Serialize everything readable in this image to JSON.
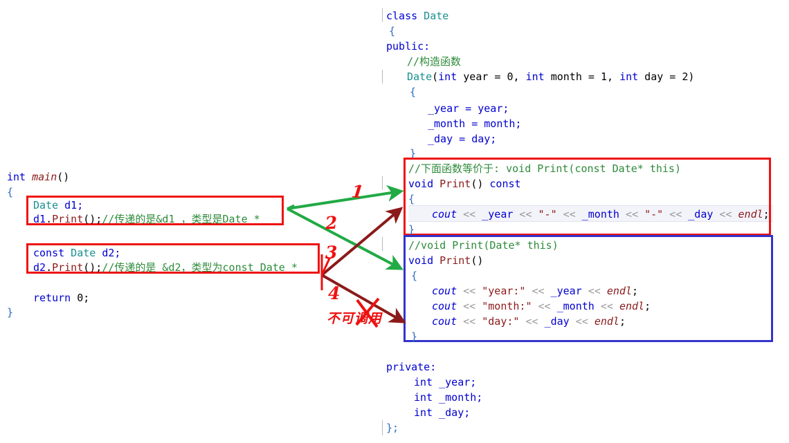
{
  "colors": {
    "keyword": "#0000d0",
    "user_type": "#1a8f8f",
    "function": "#8b1a1a",
    "comment": "#2e8b3a",
    "string": "#8b1a1a",
    "operator": "#9a9a9a",
    "box_red": "#ee1111",
    "box_blue": "#3333cc",
    "arrow_green": "#22aa44",
    "arrow_darkred": "#8b1a1a",
    "annotation_red": "#ee1111",
    "background": "#ffffff"
  },
  "left_code": {
    "line1_kw": "int",
    "line1_fn": "main",
    "line1_paren": "()",
    "line2": "{",
    "box1": {
      "l1_type": "Date",
      "l1_var": " d1;",
      "l2_var": "d1",
      "l2_dot": ".",
      "l2_fn": "Print",
      "l2_tail": "();",
      "l2_comment": "//传递的是&d1 ，类型是Date *"
    },
    "box2": {
      "l1_kw": "const",
      "l1_type": " Date",
      "l1_var": " d2;",
      "l2_var": "d2",
      "l2_dot": ".",
      "l2_fn": "Print",
      "l2_tail": "();",
      "l2_comment": "//传递的是 &d2，类型为const Date *"
    },
    "ret_kw": "return",
    "ret_val": " 0;",
    "close": "}"
  },
  "right_code": {
    "class_kw": "class",
    "class_name": " Date",
    "open_brace": "{",
    "public_kw": "public:",
    "ctor_comment": "//构造函数",
    "ctor_name": "Date",
    "ctor_sig": "(",
    "ctor_p1_kw": "int",
    "ctor_p1": " year = 0, ",
    "ctor_p2_kw": "int",
    "ctor_p2": " month = 1, ",
    "ctor_p3_kw": "int",
    "ctor_p3": " day = 2)",
    "ctor_open": "{",
    "assign1": "_year = year;",
    "assign2": "_month = month;",
    "assign3": "_day = day;",
    "ctor_close": "}",
    "private_kw": "private:",
    "member1_kw": "int",
    "member1": " _year;",
    "member2_kw": "int",
    "member2": " _month;",
    "member3_kw": "int",
    "member3": " _day;",
    "class_close": "};"
  },
  "red_box_code": {
    "comment": "//下面函数等价于: void Print(const Date* this)",
    "sig_kw": "void",
    "sig_fn": " Print",
    "sig_paren": "() ",
    "sig_const": "const",
    "open": "{",
    "body_cout": "cout",
    "body_op1": " << ",
    "body_year": "_year",
    "body_op2": " << ",
    "body_dash1": "\"-\"",
    "body_op3": " << ",
    "body_month": "_month",
    "body_op4": " << ",
    "body_dash2": "\"-\"",
    "body_op5": " << ",
    "body_day": "_day",
    "body_op6": " << ",
    "body_endl": "endl",
    "body_semi": ";",
    "close": "}"
  },
  "blue_box_code": {
    "comment": "//void Print(Date* this)",
    "sig_kw": "void",
    "sig_fn": " Print",
    "sig_paren": "()",
    "open": "{",
    "l1_cout": "cout",
    "l1_op1": " << ",
    "l1_str": "\"year:\"",
    "l1_op2": " << ",
    "l1_var": "_year",
    "l1_op3": " << ",
    "l1_endl": "endl",
    "l1_semi": ";",
    "l2_cout": "cout",
    "l2_op1": " << ",
    "l2_str": "\"month:\"",
    "l2_op2": " << ",
    "l2_var": "_month",
    "l2_op3": " << ",
    "l2_endl": "endl",
    "l2_semi": ";",
    "l3_cout": "cout",
    "l3_op1": " << ",
    "l3_str": "\"day:\"",
    "l3_op2": " << ",
    "l3_var": "_day",
    "l3_op3": " << ",
    "l3_endl": "endl",
    "l3_semi": ";",
    "close": "}"
  },
  "annotations": {
    "num1": "1",
    "num2": "2",
    "num3": "3",
    "num4": "4",
    "cannot_call": "不可调用"
  }
}
